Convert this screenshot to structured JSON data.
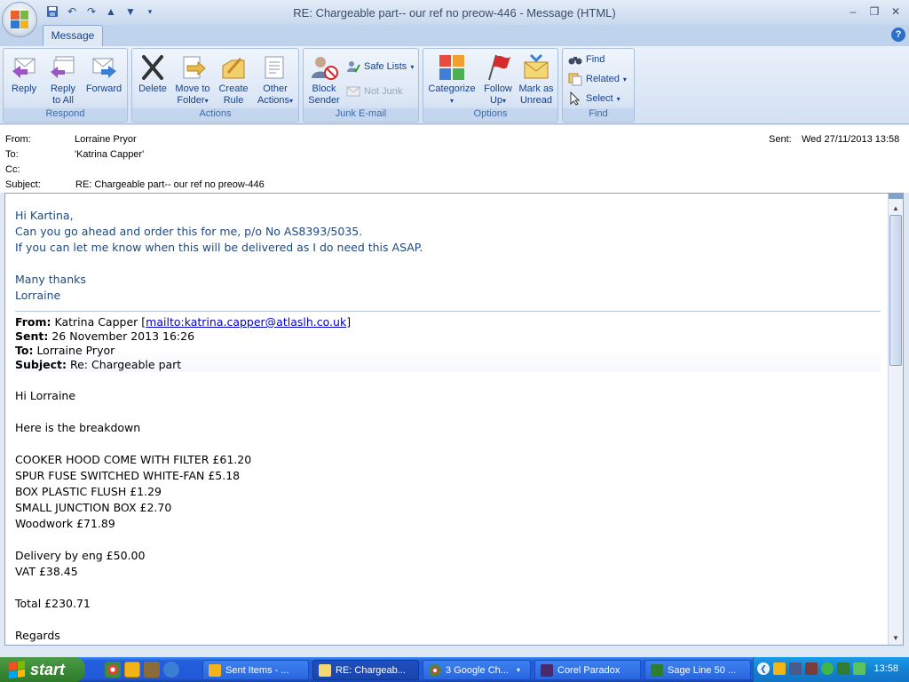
{
  "window": {
    "title": "RE: Chargeable part-- our ref no preow-446 - Message (HTML)"
  },
  "tabs": {
    "message": "Message"
  },
  "ribbon": {
    "respond": {
      "label": "Respond",
      "reply": "Reply",
      "reply_all_1": "Reply",
      "reply_all_2": "to All",
      "forward": "Forward"
    },
    "actions": {
      "label": "Actions",
      "delete": "Delete",
      "move_1": "Move to",
      "move_2": "Folder",
      "create_1": "Create",
      "create_2": "Rule",
      "other_1": "Other",
      "other_2": "Actions"
    },
    "junk": {
      "label": "Junk E-mail",
      "block_1": "Block",
      "block_2": "Sender",
      "safe_lists": "Safe Lists",
      "not_junk": "Not Junk"
    },
    "options": {
      "label": "Options",
      "categorize": "Categorize",
      "follow_1": "Follow",
      "follow_2": "Up",
      "mark_1": "Mark as",
      "mark_2": "Unread"
    },
    "find": {
      "label": "Find",
      "find": "Find",
      "related": "Related",
      "select": "Select"
    }
  },
  "header": {
    "from_label": "From:",
    "from": "Lorraine Pryor",
    "to_label": "To:",
    "to": "'Katrina Capper'",
    "cc_label": "Cc:",
    "subject_label": "Subject:",
    "subject": "RE: Chargeable part-- our ref no preow-446",
    "sent_label": "Sent:",
    "sent": "Wed 27/11/2013 13:58"
  },
  "message": {
    "greeting": "Hi Kartina,",
    "line1": "Can you go ahead and order this for me, p/o No AS8393/5035.",
    "line2": "If you can let me know when this will be delivered as I do need this ASAP.",
    "thanks": "Many thanks",
    "signoff": "Lorraine",
    "quoted": {
      "from_label": "From:",
      "from_name": "Katrina Capper [",
      "from_link": "mailto:katrina.capper@atlaslh.co.uk",
      "from_close": "]",
      "sent_label": "Sent:",
      "sent": "26 November 2013 16:26",
      "to_label": "To:",
      "to": "Lorraine Pryor",
      "subject_label": "Subject:",
      "subject": "Re: Chargeable part"
    },
    "q_greeting": "Hi Lorraine",
    "q_intro": "Here is the breakdown",
    "items": [
      "COOKER HOOD COME WITH FILTER £61.20",
      "SPUR FUSE SWITCHED WHITE-FAN £5.18",
      "BOX PLASTIC FLUSH £1.29",
      "SMALL JUNCTION BOX £2.70",
      "Woodwork £71.89"
    ],
    "delivery": "Delivery by eng £50.00",
    "vat": "VAT £38.45",
    "total": "Total £230.71",
    "regards": "Regards"
  },
  "taskbar": {
    "start": "start",
    "tasks": [
      "Sent Items - ...",
      "RE: Chargeab...",
      "3 Google Ch...",
      "Corel Paradox",
      "Sage Line 50 ..."
    ],
    "clock": "13:58"
  },
  "colors": {
    "body_text_blue": "#1f497d",
    "link": "#0000cc",
    "ribbon_label": "#15428b",
    "taskbar": "#245edc",
    "start_green": "#3a8a36"
  }
}
